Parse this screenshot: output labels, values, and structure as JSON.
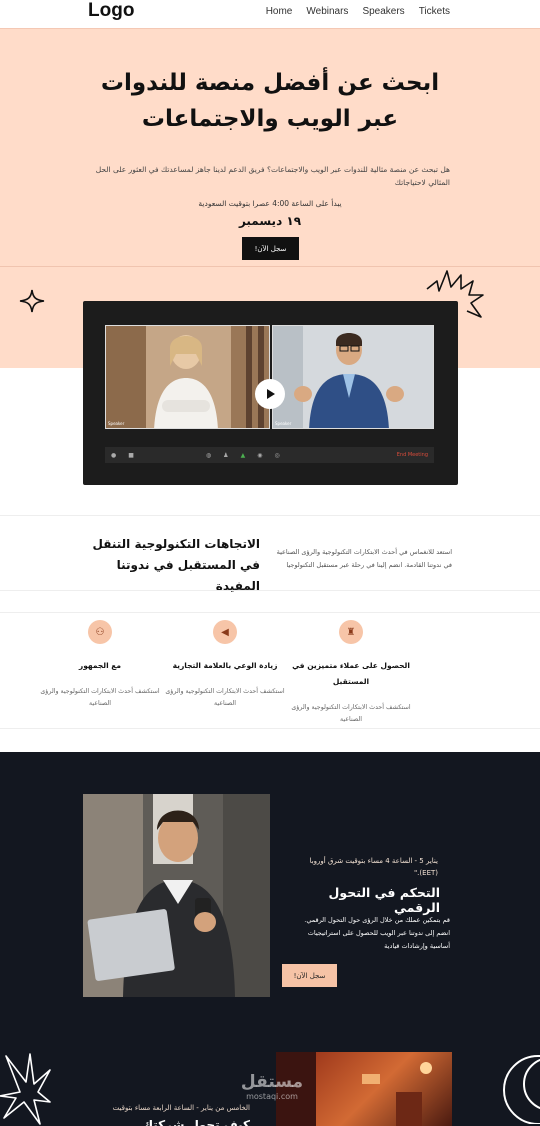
{
  "header": {
    "logo": "Logo",
    "nav": [
      "Home",
      "Webinars",
      "Speakers",
      "Tickets"
    ]
  },
  "hero": {
    "title": "ابحث عن أفضل منصة للندوات عبر الويب والاجتماعات",
    "description": "هل تبحث عن منصة مثالية للندوات عبر الويب والاجتماعات؟ فريق الدعم لدينا جاهز لمساعدتك في العثور على الحل المثالي لاحتياجاتك",
    "start_time": "يبدأ على الساعة 4:00 عصرا بتوقيت السعودية",
    "date": "١٩ ديسمبر",
    "cta": "سجل الآن!"
  },
  "video": {
    "speaker1_tag": "Speaker",
    "speaker2_tag": "Speaker",
    "end_label": "End Meeting"
  },
  "trends": {
    "title": "الاتجاهات التكنولوجية التنقل في المستقبل في ندوتنا المفيدة",
    "text": "استعد للانغماس في أحدث الابتكارات التكنولوجية والرؤى الصناعية في ندوتنا القادمة. انضم إلينا في رحلة عبر مستقبل التكنولوجيا"
  },
  "features": [
    {
      "title": "مع الجمهور",
      "desc": "استكشف أحدث الابتكارات التكنولوجية والرؤى الصناعية",
      "icon": "audience-icon"
    },
    {
      "title": "زيادة الوعي بالعلامة التجارية",
      "desc": "استكشف أحدث الابتكارات التكنولوجية والرؤى الصناعية",
      "icon": "megaphone-icon"
    },
    {
      "title": "الحصول على عملاء متميزين في المستقبل",
      "desc": "استكشف أحدث الابتكارات التكنولوجية والرؤى الصناعية",
      "icon": "clients-icon"
    }
  ],
  "event2": {
    "time": "يناير 5 - الساعة 4 مساء بتوقيت شرق أوروبا (EET).\"",
    "title": "التحكم في التحول الرقمي",
    "text": "قم بتمكين عملك من خلال الرؤى حول التحول الرقمي. انضم إلى ندوتنا عبر الويب للحصول على استراتيجيات أساسية وإرشادات قيادية",
    "cta": "سجل الآن!"
  },
  "event3": {
    "time": "الخامس من يناير - الساعة الرابعة مساء بتوقيت",
    "title": "كيف تحول شركتك"
  },
  "watermark": {
    "ar": "مستقل",
    "en": "mostaqi.com"
  },
  "colors": {
    "hero_bg": "#ffdcc9",
    "dark_bg": "#131720",
    "accent": "#f6c3a6"
  }
}
